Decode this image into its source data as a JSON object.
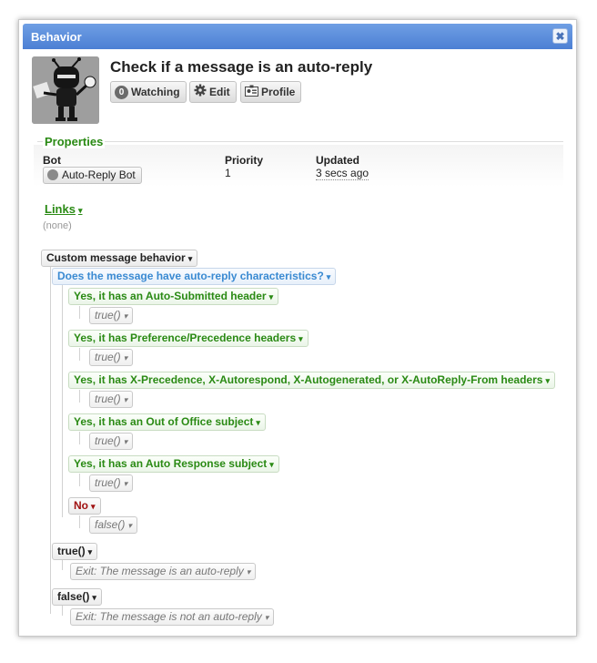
{
  "dialog": {
    "title": "Behavior",
    "close_label": "✖"
  },
  "header": {
    "page_title": "Check if a message is an auto-reply",
    "buttons": {
      "watching_count": "0",
      "watching_label": "Watching",
      "edit_label": "Edit",
      "profile_label": "Profile"
    }
  },
  "properties": {
    "section_title": "Properties",
    "bot_header": "Bot",
    "bot_value": "Auto-Reply Bot",
    "priority_header": "Priority",
    "priority_value": "1",
    "updated_header": "Updated",
    "updated_value": "3 secs ago"
  },
  "links": {
    "title": "Links",
    "empty": "(none)"
  },
  "tree": {
    "root": "Custom message behavior",
    "question": "Does the message have auto-reply characteristics?",
    "branches": [
      {
        "label": "Yes, it has an Auto-Submitted header",
        "result": "true()"
      },
      {
        "label": "Yes, it has Preference/Precedence headers",
        "result": "true()"
      },
      {
        "label": "Yes, it has X-Precedence, X-Autorespond, X-Autogenerated, or X-AutoReply-From headers",
        "result": "true()"
      },
      {
        "label": "Yes, it has an Out of Office subject",
        "result": "true()"
      },
      {
        "label": "Yes, it has an Auto Response subject",
        "result": "true()"
      },
      {
        "label": "No",
        "result": "false()"
      }
    ],
    "outcome_true": {
      "label": "true()",
      "exit": "Exit: The message is an auto-reply"
    },
    "outcome_false": {
      "label": "false()",
      "exit": "Exit: The message is not an auto-reply"
    }
  },
  "icons": {
    "caret": "▾",
    "close": "close-icon",
    "edit": "gear-icon",
    "profile": "profile-card-icon",
    "bot": "robot-icon"
  },
  "colors": {
    "titlebar": "#5a8ad9",
    "section_green": "#2a8a14",
    "question_blue": "#3a8ad2",
    "no_red": "#a01010"
  }
}
